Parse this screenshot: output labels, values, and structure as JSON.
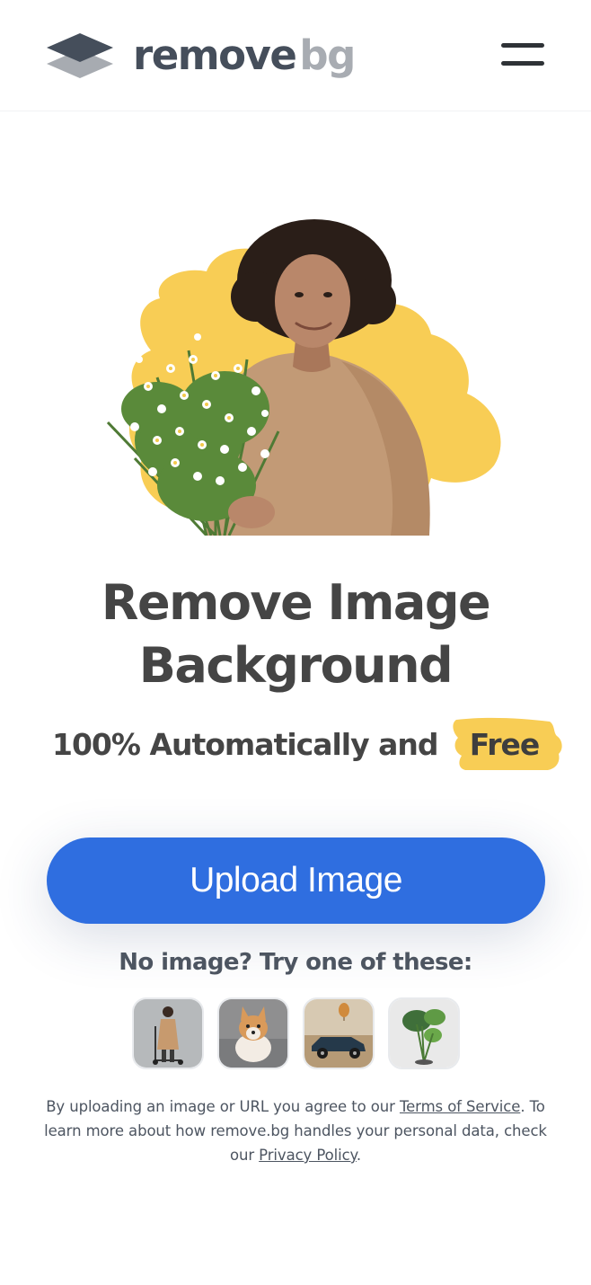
{
  "header": {
    "logo_remove": "remove",
    "logo_bg": "bg"
  },
  "hero": {
    "title_line1": "Remove Image",
    "title_line2": "Background",
    "subtitle": "100% Automatically and",
    "free_badge": "Free"
  },
  "upload": {
    "label": "Upload Image"
  },
  "samples": {
    "label": "No image? Try one of these:",
    "items": [
      "woman-with-scooter",
      "corgi-dog",
      "vintage-car",
      "potted-plant"
    ]
  },
  "legal": {
    "part1": "By uploading an image or URL you agree to our",
    "terms_link": "Terms of Service",
    "part2": ". To learn more about how remove.bg handles your personal data, check our",
    "privacy_link": "Privacy Policy",
    "part3": "."
  },
  "colors": {
    "brand_blue": "#2f6ee0",
    "accent_yellow": "#f8cd55",
    "text_dark": "#454545"
  }
}
